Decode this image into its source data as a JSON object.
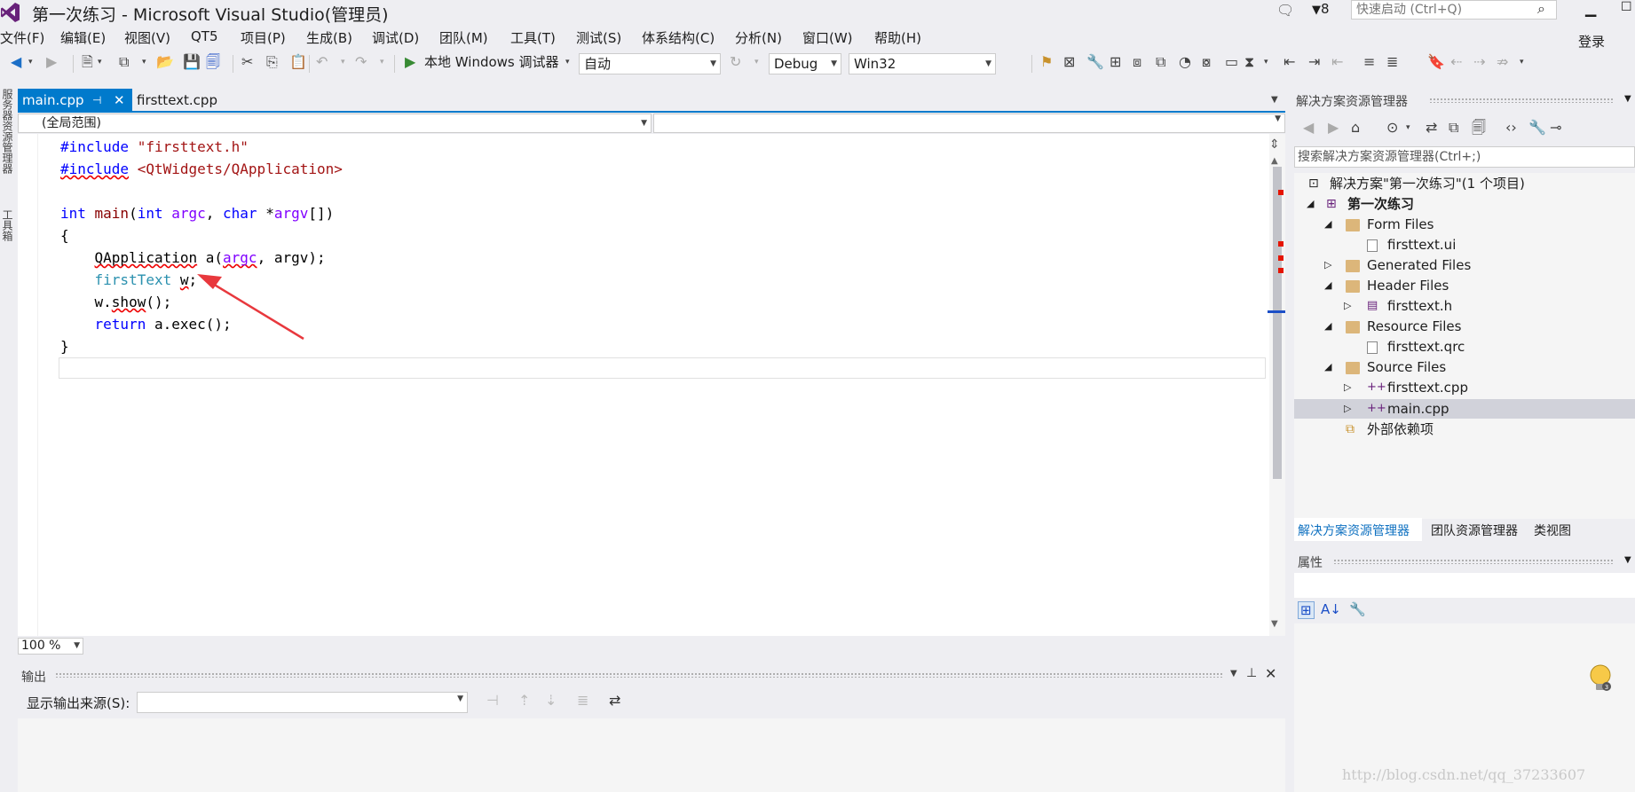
{
  "window": {
    "title": "第一次练习 - Microsoft Visual Studio(管理员)",
    "flag_count": "8",
    "quick_launch_placeholder": "快速启动 (Ctrl+Q)",
    "login": "登录"
  },
  "menu": [
    "文件(F)",
    "编辑(E)",
    "视图(V)",
    "QT5",
    "项目(P)",
    "生成(B)",
    "调试(D)",
    "团队(M)",
    "工具(T)",
    "测试(S)",
    "体系结构(C)",
    "分析(N)",
    "窗口(W)",
    "帮助(H)"
  ],
  "toolbar": {
    "run_label": "本地 Windows 调试器",
    "auto_combo": "自动",
    "config_combo": "Debug",
    "platform_combo": "Win32"
  },
  "left_strip": {
    "server_explorer": "服务器资源管理器",
    "toolbox": "工具箱"
  },
  "editor": {
    "tabs": [
      {
        "label": "main.cpp",
        "active": true
      },
      {
        "label": "firsttext.cpp",
        "active": false
      }
    ],
    "scope": "(全局范围)",
    "zoom": "100 %",
    "code_lines": [
      "#include \"firsttext.h\"",
      "#include <QtWidgets/QApplication>",
      "",
      "int main(int argc, char *argv[])",
      "{",
      "    QApplication a(argc, argv);",
      "    firstText w;",
      "    w.show();",
      "    return a.exec();",
      "}"
    ]
  },
  "output": {
    "title": "输出",
    "source_label": "显示输出来源(S):",
    "source_value": ""
  },
  "solution_explorer": {
    "title": "解决方案资源管理器",
    "search_placeholder": "搜索解决方案资源管理器(Ctrl+;)",
    "solution": "解决方案\"第一次练习\"(1 个项目)",
    "project": "第一次练习",
    "nodes": {
      "form_files": "Form Files",
      "firsttext_ui": "firsttext.ui",
      "generated_files": "Generated Files",
      "header_files": "Header Files",
      "firsttext_h": "firsttext.h",
      "resource_files": "Resource Files",
      "firsttext_qrc": "firsttext.qrc",
      "source_files": "Source Files",
      "firsttext_cpp": "firsttext.cpp",
      "main_cpp": "main.cpp",
      "external_deps": "外部依赖项"
    },
    "selected": "main.cpp",
    "bottom_tabs": [
      "解决方案资源管理器",
      "团队资源管理器",
      "类视图"
    ]
  },
  "properties": {
    "title": "属性"
  },
  "watermark": "http://blog.csdn.net/qq_37233607",
  "colors": {
    "accent": "#007acc",
    "keyword": "#0000ff",
    "string": "#a31515",
    "type": "#2b91af",
    "param": "#8000ff",
    "arrow": "#e8383d"
  },
  "icons": [
    "vs-logo-icon",
    "notification-icon",
    "filter-flag-icon",
    "search-icon",
    "back-icon",
    "forward-icon",
    "new-project-icon",
    "open-icon",
    "save-icon",
    "save-all-icon",
    "cut-icon",
    "copy-icon",
    "paste-icon",
    "undo-icon",
    "redo-icon",
    "play-icon",
    "refresh-icon",
    "bookmark-icon",
    "pin-icon",
    "close-icon",
    "home-icon",
    "sync-icon",
    "collapse-icon",
    "properties-icon",
    "bulb-icon"
  ]
}
